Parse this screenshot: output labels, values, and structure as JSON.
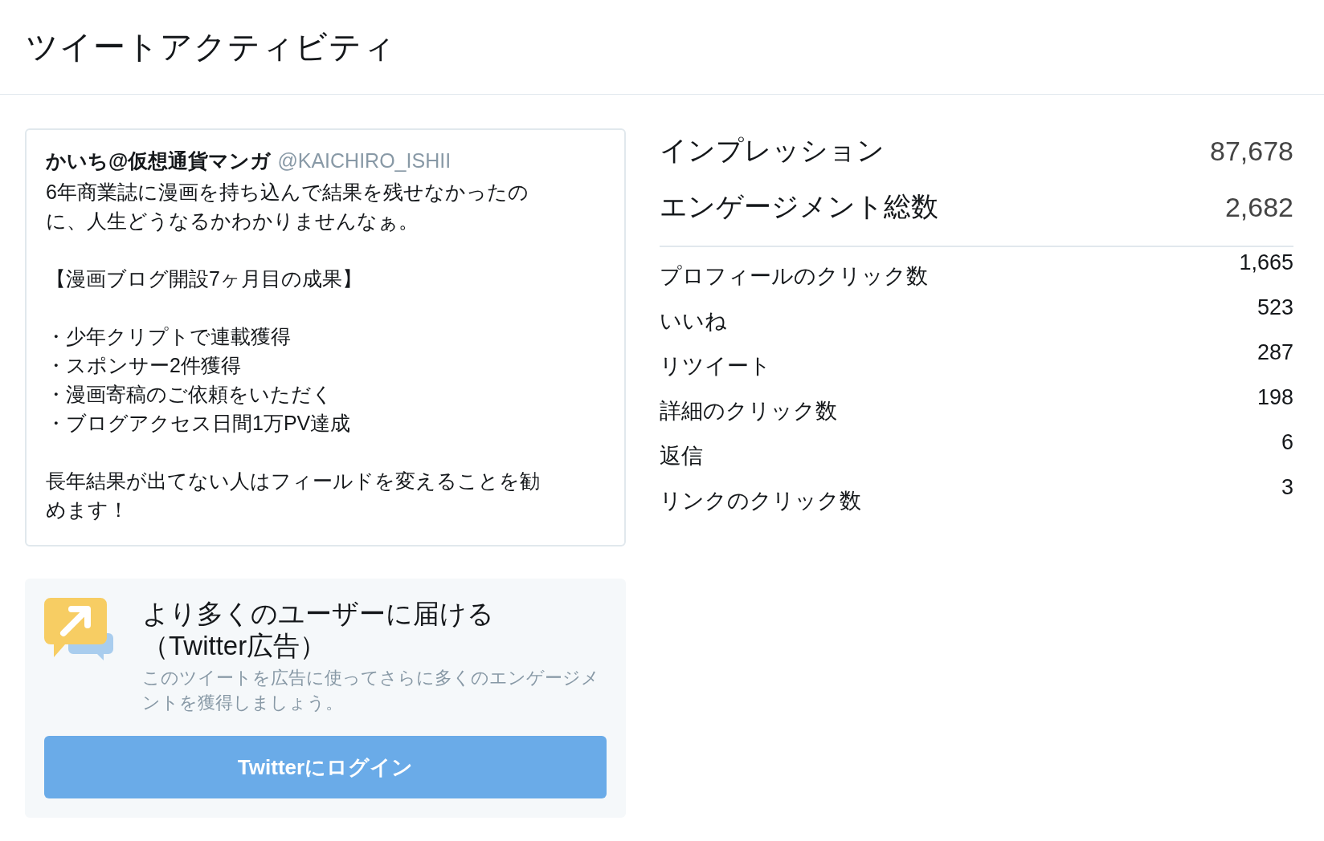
{
  "page_title": "ツイートアクティビティ",
  "tweet": {
    "name": "かいち@仮想通貨マンガ",
    "handle": "@KAICHIRO_ISHII",
    "paragraphs": [
      [
        "6年商業誌に漫画を持ち込んで結果を残せなかったのに、人生どうなるかわかりませんなぁ。"
      ],
      [
        "【漫画ブログ開設7ヶ月目の成果】"
      ],
      [
        "・少年クリプトで連載獲得",
        "・スポンサー2件獲得",
        "・漫画寄稿のご依頼をいただく",
        "・ブログアクセス日間1万PV達成"
      ],
      [
        "長年結果が出てない人はフィールドを変えることを勧めます！"
      ]
    ]
  },
  "promo": {
    "title": "より多くのユーザーに届ける（Twitter広告）",
    "description": "このツイートを広告に使ってさらに多くのエンゲージメントを獲得しましょう。",
    "button": "Twitterにログイン"
  },
  "summary": [
    {
      "label": "インプレッション",
      "value": "87,678"
    },
    {
      "label": "エンゲージメント総数",
      "value": "2,682"
    }
  ],
  "details": [
    {
      "label": "プロフィールのクリック数",
      "value": "1,665"
    },
    {
      "label": "いいね",
      "value": "523"
    },
    {
      "label": "リツイート",
      "value": "287"
    },
    {
      "label": "詳細のクリック数",
      "value": "198"
    },
    {
      "label": "返信",
      "value": "6"
    },
    {
      "label": "リンクのクリック数",
      "value": "3"
    }
  ]
}
